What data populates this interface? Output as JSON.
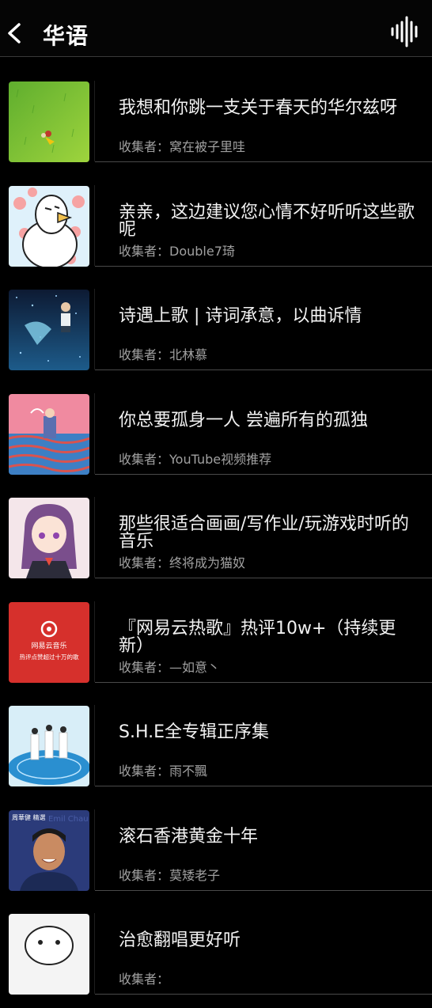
{
  "header": {
    "title": "华语"
  },
  "collector_prefix": "收集者：",
  "playlists": [
    {
      "name": "我想和你跳一支关于春天的华尔兹呀",
      "collector": "窝在被子里哇"
    },
    {
      "name": "亲亲，这边建议您心情不好听听这些歌呢",
      "collector": "Double7琦"
    },
    {
      "name": "诗遇上歌 | 诗词承意，以曲诉情",
      "collector": "北林慕"
    },
    {
      "name": "你总要孤身一人 尝遍所有的孤独",
      "collector": "YouTube视频推荐"
    },
    {
      "name": "那些很适合画画/写作业/玩游戏时听的音乐",
      "collector": "终将成为猫奴"
    },
    {
      "name": "『网易云热歌』热评10w+（持续更新）",
      "collector": "—如意丶"
    },
    {
      "name": "S.H.E全专辑正序集",
      "collector": "雨不飄"
    },
    {
      "name": "滚石香港黄金十年",
      "collector": "莫矮老子"
    },
    {
      "name": "治愈翻唱更好听",
      "collector": ""
    }
  ],
  "covers": {
    "netease_brand": "网易云音乐",
    "netease_tagline": "热评点赞超过十万的歌",
    "emperor_label": "周華健 精選",
    "emperor_overlay": "Emil Chau"
  }
}
